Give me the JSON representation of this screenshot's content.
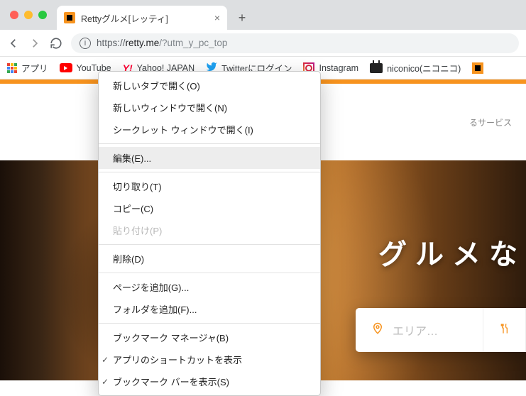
{
  "tab": {
    "title": "Rettyグルメ[レッティ]"
  },
  "url": {
    "protocol": "https://",
    "host": "retty.me",
    "path": "/?utm_y_pc_top"
  },
  "bookmarks": {
    "apps": "アプリ",
    "items": [
      {
        "label": "YouTube"
      },
      {
        "label": "Yahoo! JAPAN"
      },
      {
        "label": "Twitterにログイン"
      },
      {
        "label": "Instagram"
      },
      {
        "label": "niconico(ニコニコ)"
      }
    ]
  },
  "page": {
    "header_tagline_fragment": "るサービス",
    "hero_title_fragment": "グルメな",
    "search": {
      "area_placeholder": "エリア…"
    }
  },
  "context_menu": {
    "items": [
      {
        "label": "新しいタブで開く(O)",
        "type": "item"
      },
      {
        "label": "新しいウィンドウで開く(N)",
        "type": "item"
      },
      {
        "label": "シークレット ウィンドウで開く(I)",
        "type": "item"
      },
      {
        "type": "sep"
      },
      {
        "label": "編集(E)...",
        "type": "item",
        "highlight": true
      },
      {
        "type": "sep"
      },
      {
        "label": "切り取り(T)",
        "type": "item"
      },
      {
        "label": "コピー(C)",
        "type": "item"
      },
      {
        "label": "貼り付け(P)",
        "type": "item",
        "disabled": true
      },
      {
        "type": "sep"
      },
      {
        "label": "削除(D)",
        "type": "item"
      },
      {
        "type": "sep"
      },
      {
        "label": "ページを追加(G)...",
        "type": "item"
      },
      {
        "label": "フォルダを追加(F)...",
        "type": "item"
      },
      {
        "type": "sep"
      },
      {
        "label": "ブックマーク マネージャ(B)",
        "type": "item"
      },
      {
        "label": "アプリのショートカットを表示",
        "type": "item",
        "checked": true
      },
      {
        "label": "ブックマーク バーを表示(S)",
        "type": "item",
        "checked": true
      }
    ]
  }
}
